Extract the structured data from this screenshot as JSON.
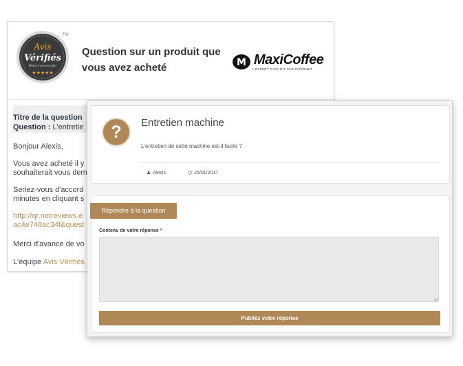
{
  "email": {
    "badge": {
      "line1": "Avis",
      "line2": "Vérifiés",
      "line3": "Même internet safer",
      "tm": "TM"
    },
    "title_line1": "Question sur un produit que",
    "title_line2": "vous avez acheté",
    "brand": {
      "name": "MaxiCoffee",
      "tagline": "L'EXPERT CAFÉ N°1 SUR INTERNET",
      "logo_letter": "M"
    },
    "question_box": {
      "line1": "Titre de la question",
      "line2_label": "Question :",
      "line2_value": "L'entretie"
    },
    "greeting": "Bonjour Alexis,",
    "para1_l1": "Vous avez acheté il y",
    "para1_l2": "souhaiterait vous dem",
    "para2_l1": "Seriez-vous d'accord",
    "para2_l2": "minutes en cliquant s",
    "link_l1": "http://qr.netreviews.e",
    "link_l2": "ac4e748ac34f&quest",
    "thanks": "Merci d'avance de vo",
    "signoff_prefix": "L'équipe",
    "signoff_link": "Avis Vérifiés"
  },
  "question": {
    "title": "Entretien machine",
    "text": "L'entretien de cette machine est-il facile ?",
    "icon_glyph": "?",
    "author": "Alexis",
    "date": "25/01/2017",
    "author_icon": "user-icon",
    "date_icon": "clock-icon"
  },
  "answer": {
    "tab_label": "Répondre à la question",
    "field_label": "Contenu de votre réponse",
    "required_mark": "*",
    "field_value": "",
    "field_placeholder": "",
    "submit_label": "Publiez votre réponse"
  },
  "colors": {
    "accent": "#b08757",
    "link": "#b8935e",
    "badge_gold": "#e8a33a"
  }
}
